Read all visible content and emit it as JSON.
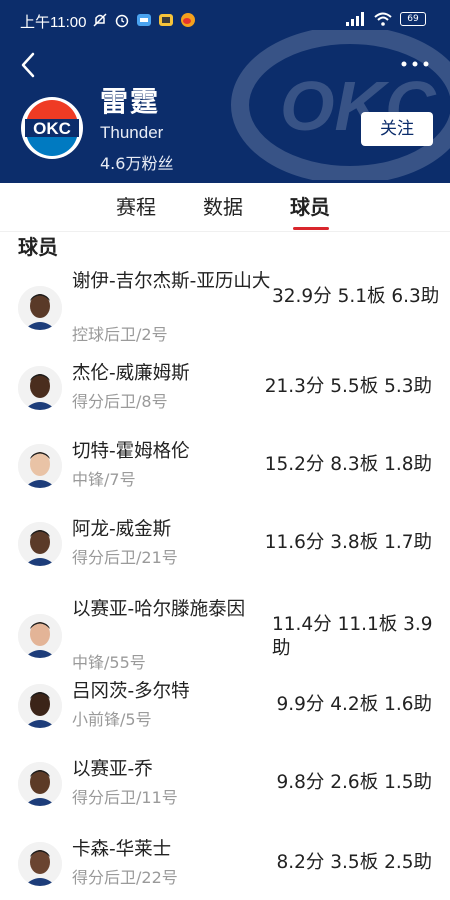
{
  "status_bar": {
    "time": "上午11:00",
    "battery": "69"
  },
  "team": {
    "name": "雷霆",
    "english_name": "Thunder",
    "fans": "4.6万粉丝",
    "logo_text": "OKC",
    "follow_label": "关注"
  },
  "tabs": [
    {
      "label": "赛程",
      "active": false
    },
    {
      "label": "数据",
      "active": false
    },
    {
      "label": "球员",
      "active": true
    }
  ],
  "section_title": "球员",
  "players": [
    {
      "name": "谢伊-吉尔杰斯-亚历山大",
      "position": "控球后卫/2号",
      "stats": "32.9分 5.1板 6.3助",
      "skin": "#5a3a28"
    },
    {
      "name": "杰伦-威廉姆斯",
      "position": "得分后卫/8号",
      "stats": "21.3分 5.5板 5.3助",
      "skin": "#4a2d1e"
    },
    {
      "name": "切特-霍姆格伦",
      "position": "中锋/7号",
      "stats": "15.2分 8.3板 1.8助",
      "skin": "#e9c3a6"
    },
    {
      "name": "阿龙-威金斯",
      "position": "得分后卫/21号",
      "stats": "11.6分 3.8板 1.7助",
      "skin": "#5b3a28"
    },
    {
      "name": "以赛亚-哈尔滕施泰因",
      "position": "中锋/55号",
      "stats": "11.4分 11.1板 3.9助",
      "skin": "#e3b497"
    },
    {
      "name": "吕冈茨-多尔特",
      "position": "小前锋/5号",
      "stats": "9.9分 4.2板 1.6助",
      "skin": "#3b2418"
    },
    {
      "name": "以赛亚-乔",
      "position": "得分后卫/11号",
      "stats": "9.8分 2.6板 1.5助",
      "skin": "#5c3a26"
    },
    {
      "name": "卡森-华莱士",
      "position": "得分后卫/22号",
      "stats": "8.2分 3.5板 2.5助",
      "skin": "#6a4430"
    }
  ],
  "colors": {
    "header_bg": "#0c2d6b",
    "accent": "#d9262c",
    "logo_orange": "#ef3b24",
    "logo_blue": "#007ac1"
  }
}
